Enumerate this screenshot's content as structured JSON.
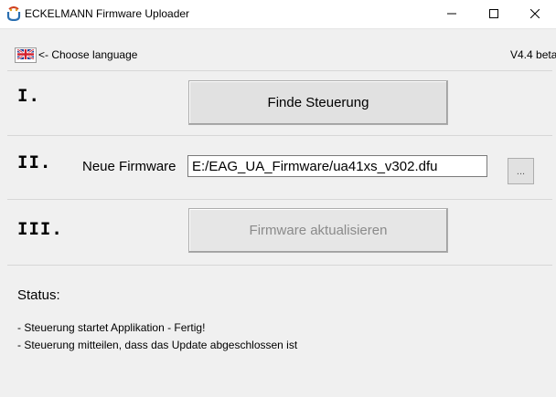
{
  "window": {
    "title": "ECKELMANN Firmware Uploader",
    "icon": "eckelmann-app-icon",
    "controls": [
      "minimize-icon",
      "maximize-icon",
      "close-icon"
    ]
  },
  "language": {
    "flag": "uk-flag-icon",
    "label": "<- Choose language"
  },
  "version": "V4.4 beta",
  "steps": {
    "one": {
      "numeral": "I.",
      "button_label": "Finde Steuerung"
    },
    "two": {
      "numeral": "II.",
      "field_label": "Neue Firmware",
      "field_value": "E:/EAG_UA_Firmware/ua41xs_v302.dfu",
      "browse_label": "..."
    },
    "three": {
      "numeral": "III.",
      "button_label": "Firmware aktualisieren",
      "enabled": false
    }
  },
  "status": {
    "label": "Status:",
    "log": [
      "- Steuerung startet Applikation - Fertig!",
      "- Steuerung mitteilen, dass das Update abgeschlossen ist"
    ]
  },
  "colors": {
    "background": "#f0f0f0",
    "titlebar": "#ffffff",
    "button_face": "#e1e1e1",
    "disabled_text": "#8a8a8a"
  }
}
